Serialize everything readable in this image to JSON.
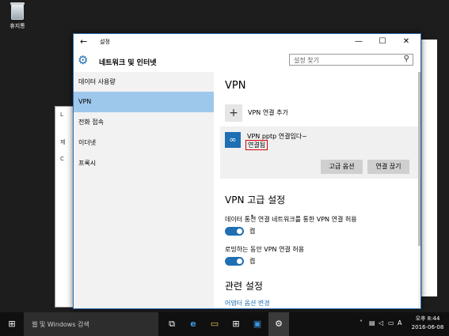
{
  "desktop": {
    "recycle_bin_label": "휴지통"
  },
  "window": {
    "title": "설정",
    "controls": {
      "minimize": "—",
      "maximize": "☐",
      "close": "✕"
    },
    "back": "←"
  },
  "header": {
    "title": "네트워크 및 인터넷",
    "gear": "⚙"
  },
  "search": {
    "placeholder": "설정 찾기",
    "icon": "⚲"
  },
  "nav": {
    "items": [
      {
        "label": "데이터 사용량",
        "active": false
      },
      {
        "label": "VPN",
        "active": true
      },
      {
        "label": "전화 접속",
        "active": false
      },
      {
        "label": "이더넷",
        "active": false
      },
      {
        "label": "프록시",
        "active": false
      }
    ]
  },
  "content": {
    "title": "VPN",
    "add_label": "VPN 연결 추가",
    "add_icon": "+",
    "connection": {
      "name": "VPN pptp 연결임다~",
      "status": "연결됨",
      "icon": "∞",
      "advanced_button": "고급 옵션",
      "disconnect_button": "연결 끊기"
    },
    "advanced": {
      "title": "VPN 고급 설정",
      "option1_label": "데이터 통신 연결 네트워크를 통한 VPN 연결 허용",
      "option1_state": "켬",
      "option2_label": "로밍하는 동안 VPN 연결 허용",
      "option2_state": "켬"
    },
    "related": {
      "title": "관련 설정",
      "link": "어댑터 옵션 변경"
    }
  },
  "taskbar": {
    "search_text": "웹 및 Windows 검색",
    "start_icon": "⊞",
    "icons": [
      "⧉",
      "e",
      "▭",
      "⊞",
      "▣",
      "⚙"
    ],
    "tray_icons": [
      "˄",
      "▤",
      "◁",
      "▭",
      "A"
    ],
    "time": "오후 8:44",
    "date": "2016-06-08"
  },
  "bg_window": {
    "chars": [
      "L",
      "제",
      "C"
    ]
  },
  "cursor": "↖",
  "accent": "#1f6fb2",
  "nav_active_color": "#9ec7ec",
  "status_border_color": "#d60000"
}
